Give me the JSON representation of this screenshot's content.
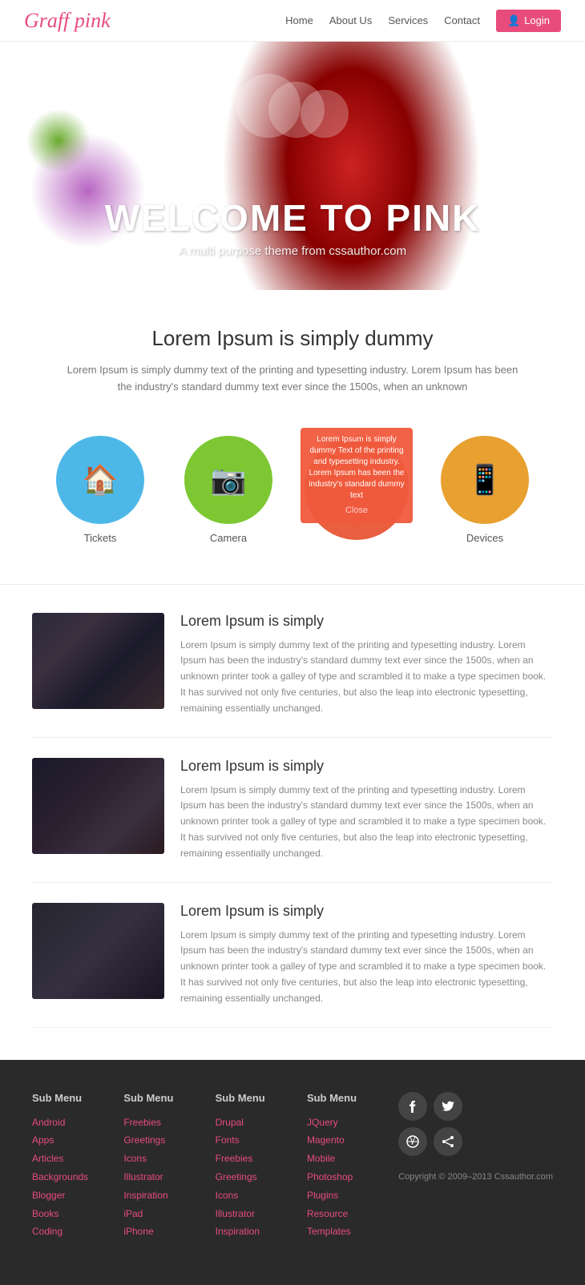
{
  "header": {
    "logo_text": "Graff",
    "logo_accent": "pink",
    "nav": {
      "home": "Home",
      "about": "About Us",
      "services": "Services",
      "contact": "Contact",
      "login": "Login"
    }
  },
  "hero": {
    "title": "WELCOME TO PINK",
    "subtitle": "A multi purpose theme from cssauthor.com"
  },
  "intro": {
    "heading": "Lorem Ipsum is simply dummy",
    "body": "Lorem Ipsum is simply dummy text of the printing and typesetting industry. Lorem Ipsum has been the industry's standard dummy text ever since the 1500s, when an unknown"
  },
  "icons": [
    {
      "label": "Tickets",
      "color_class": "ic-blue",
      "symbol": "🏠"
    },
    {
      "label": "Camera",
      "color_class": "ic-green",
      "symbol": "📷"
    },
    {
      "label": "",
      "color_class": "ic-red",
      "symbol": ""
    },
    {
      "label": "Devices",
      "color_class": "ic-orange",
      "symbol": "📱"
    }
  ],
  "tooltip": {
    "text": "Lorem Ipsum is simply dummy Text of the printing and typesetting industry. Lorem Ipsum has been the industry's standard dummy text",
    "close": "Close"
  },
  "posts": [
    {
      "title": "Lorem Ipsum is simply",
      "body": "Lorem Ipsum is simply dummy text of the printing and typesetting industry. Lorem Ipsum has been the industry's standard dummy text ever since the 1500s, when an unknown printer took a galley of type and scrambled it to make a type specimen book. It has survived not only five centuries, but also the leap into electronic typesetting, remaining essentially unchanged."
    },
    {
      "title": "Lorem Ipsum is simply",
      "body": "Lorem Ipsum is simply dummy text of the printing and typesetting industry. Lorem Ipsum has been the industry's standard dummy text ever since the 1500s, when an unknown printer took a galley of type and scrambled it to make a type specimen book. It has survived not only five centuries, but also the leap into electronic typesetting, remaining essentially unchanged."
    },
    {
      "title": "Lorem Ipsum is simply",
      "body": "Lorem Ipsum is simply dummy text of the printing and typesetting industry. Lorem Ipsum has been the industry's standard dummy text ever since the 1500s, when an unknown printer took a galley of type and scrambled it to make a type specimen book. It has survived not only five centuries, but also the leap into electronic typesetting, remaining essentially unchanged."
    }
  ],
  "footer": {
    "columns": [
      {
        "heading": "Sub Menu",
        "links": [
          "Android",
          "Apps",
          "Articles",
          "Backgrounds",
          "Blogger",
          "Books",
          "Coding"
        ]
      },
      {
        "heading": "Sub Menu",
        "links": [
          "Freebies",
          "Greetings",
          "Icons",
          "Illustrator",
          "Inspiration",
          "iPad",
          "iPhone"
        ]
      },
      {
        "heading": "Sub Menu",
        "links": [
          "Drupal",
          "Fonts",
          "Freebies",
          "Greetings",
          "Icons",
          "Illustrator",
          "Inspiration"
        ]
      },
      {
        "heading": "Sub Menu",
        "links": [
          "JQuery",
          "Magento",
          "Mobile",
          "Photoshop",
          "Plugins",
          "Resource",
          "Templates"
        ]
      }
    ],
    "copyright": "Copyright © 2009–2013 Cssauthor.com",
    "social": [
      {
        "name": "facebook",
        "symbol": "f"
      },
      {
        "name": "twitter",
        "symbol": "t"
      },
      {
        "name": "dribbble",
        "symbol": "⊕"
      },
      {
        "name": "share",
        "symbol": "↗"
      }
    ]
  }
}
